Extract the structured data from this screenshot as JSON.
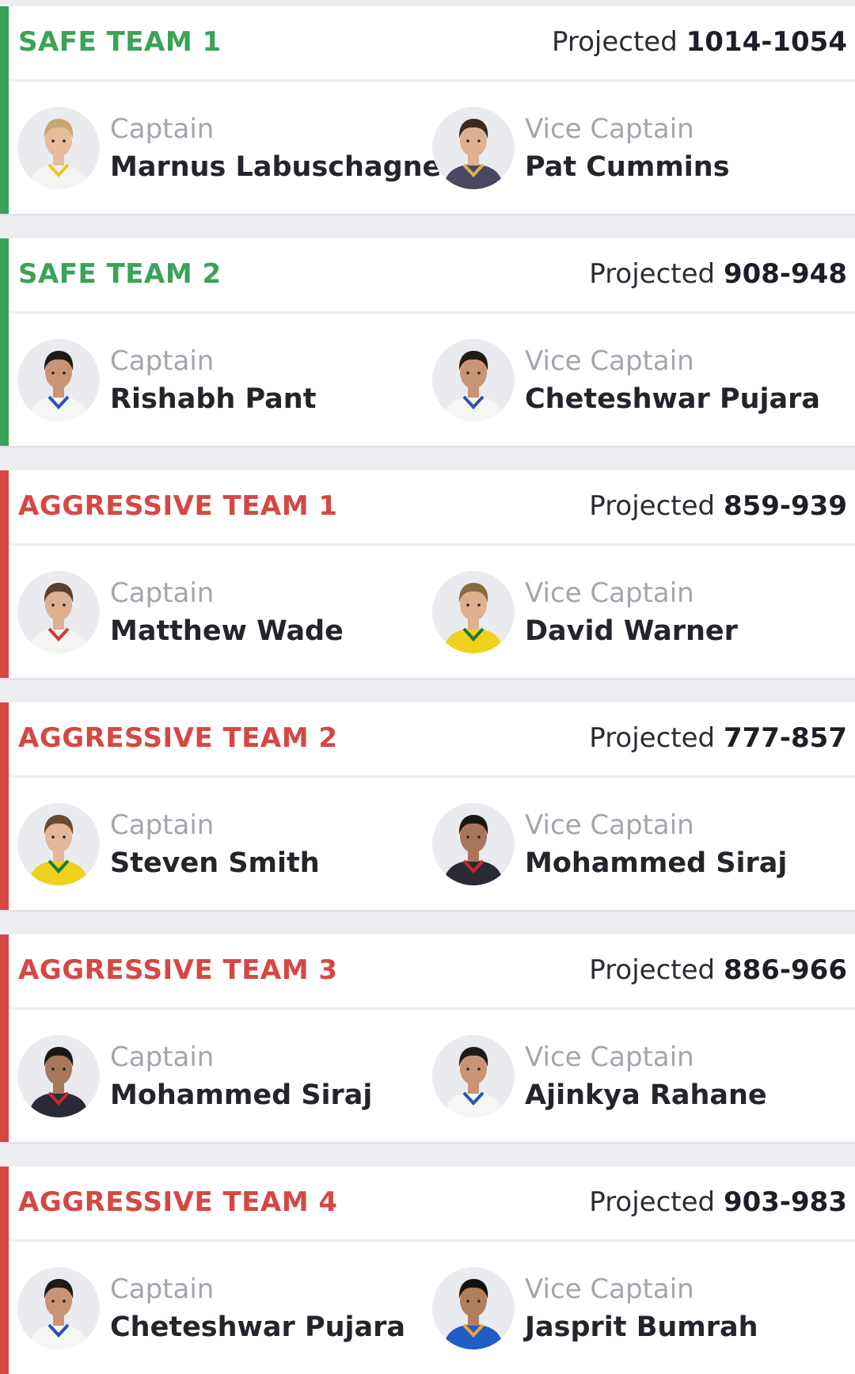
{
  "colors": {
    "safe": "#3aa357",
    "aggressive": "#d64744",
    "background": "#eceef2"
  },
  "projected_label": "Projected",
  "teams": [
    {
      "type": "safe",
      "name": "SAFE TEAM 1",
      "range": "1014-1054",
      "captain": {
        "role": "Captain",
        "name": "Marnus Labuschagne",
        "jersey": "#f4f4f2",
        "accent": "#e8c828",
        "skin": "#e6bc9c",
        "hair": "#caa571"
      },
      "vice": {
        "role": "Vice Captain",
        "name": "Pat Cummins",
        "jersey": "#4a4760",
        "accent": "#d6b14a",
        "skin": "#deb090",
        "hair": "#3a2a1e"
      }
    },
    {
      "type": "safe",
      "name": "SAFE TEAM 2",
      "range": "908-948",
      "captain": {
        "role": "Captain",
        "name": "Rishabh Pant",
        "jersey": "#f6f6f4",
        "accent": "#2a56a8",
        "skin": "#c89474",
        "hair": "#1e1a18"
      },
      "vice": {
        "role": "Vice Captain",
        "name": "Cheteshwar Pujara",
        "jersey": "#f6f6f4",
        "accent": "#2a56a8",
        "skin": "#c89474",
        "hair": "#1e1a18"
      }
    },
    {
      "type": "aggressive",
      "name": "AGGRESSIVE TEAM 1",
      "range": "859-939",
      "captain": {
        "role": "Captain",
        "name": "Matthew Wade",
        "jersey": "#f4f4f2",
        "accent": "#d13a3a",
        "skin": "#dcb090",
        "hair": "#5a4030"
      },
      "vice": {
        "role": "Vice Captain",
        "name": "David Warner",
        "jersey": "#f0d21e",
        "accent": "#1f7a3a",
        "skin": "#dcb090",
        "hair": "#8a6a42"
      }
    },
    {
      "type": "aggressive",
      "name": "AGGRESSIVE TEAM 2",
      "range": "777-857",
      "captain": {
        "role": "Captain",
        "name": "Steven Smith",
        "jersey": "#f0d21e",
        "accent": "#1f7a3a",
        "skin": "#e2b898",
        "hair": "#6a4a30"
      },
      "vice": {
        "role": "Vice Captain",
        "name": "Mohammed Siraj",
        "jersey": "#2a2a36",
        "accent": "#c32c2c",
        "skin": "#a8765a",
        "hair": "#1a1614"
      }
    },
    {
      "type": "aggressive",
      "name": "AGGRESSIVE TEAM 3",
      "range": "886-966",
      "captain": {
        "role": "Captain",
        "name": "Mohammed Siraj",
        "jersey": "#2a2a36",
        "accent": "#c32c2c",
        "skin": "#a8765a",
        "hair": "#1a1614"
      },
      "vice": {
        "role": "Vice Captain",
        "name": "Ajinkya Rahane",
        "jersey": "#f6f6f4",
        "accent": "#2a56a8",
        "skin": "#c89474",
        "hair": "#1e1a18"
      }
    },
    {
      "type": "aggressive",
      "name": "AGGRESSIVE TEAM 4",
      "range": "903-983",
      "captain": {
        "role": "Captain",
        "name": "Cheteshwar Pujara",
        "jersey": "#f6f6f4",
        "accent": "#2a56a8",
        "skin": "#c89474",
        "hair": "#1e1a18"
      },
      "vice": {
        "role": "Vice Captain",
        "name": "Jasprit Bumrah",
        "jersey": "#1f5cc4",
        "accent": "#f0a03a",
        "skin": "#b27e5c",
        "hair": "#141210"
      }
    }
  ]
}
